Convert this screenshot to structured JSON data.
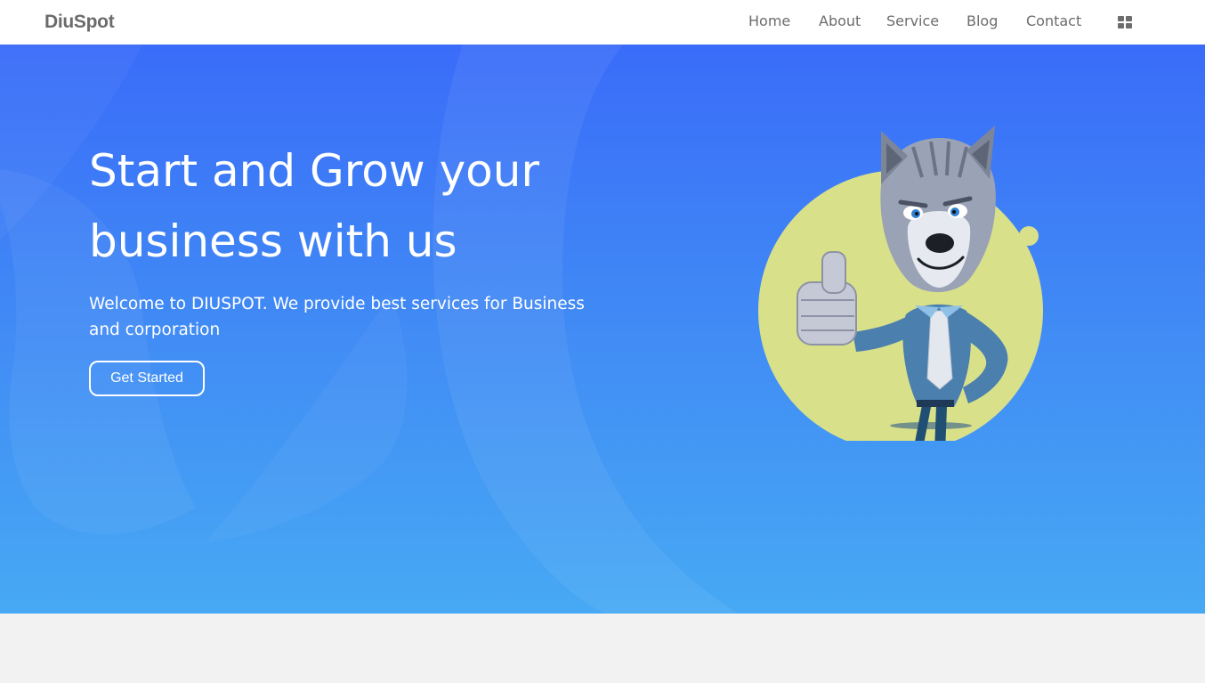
{
  "brand": {
    "name": "DiuSpot"
  },
  "nav": {
    "items": [
      {
        "label": "Home"
      },
      {
        "label": "About"
      },
      {
        "label": "Service"
      },
      {
        "label": "Blog"
      },
      {
        "label": "Contact"
      }
    ],
    "menu_icon": "grid-icon"
  },
  "hero": {
    "title": "Start and Grow your business with us",
    "subtitle": "Welcome to DIUSPOT. We provide best services for Business and corporation",
    "cta_label": "Get Started",
    "illustration": "wolf-mascot-thumbs-up"
  },
  "colors": {
    "hero_top": "#3a6cf9",
    "hero_bottom": "#47a9f4",
    "accent_circle": "#d9e08a",
    "nav_text": "#6d6d6d",
    "page_bg": "#f2f2f2"
  }
}
